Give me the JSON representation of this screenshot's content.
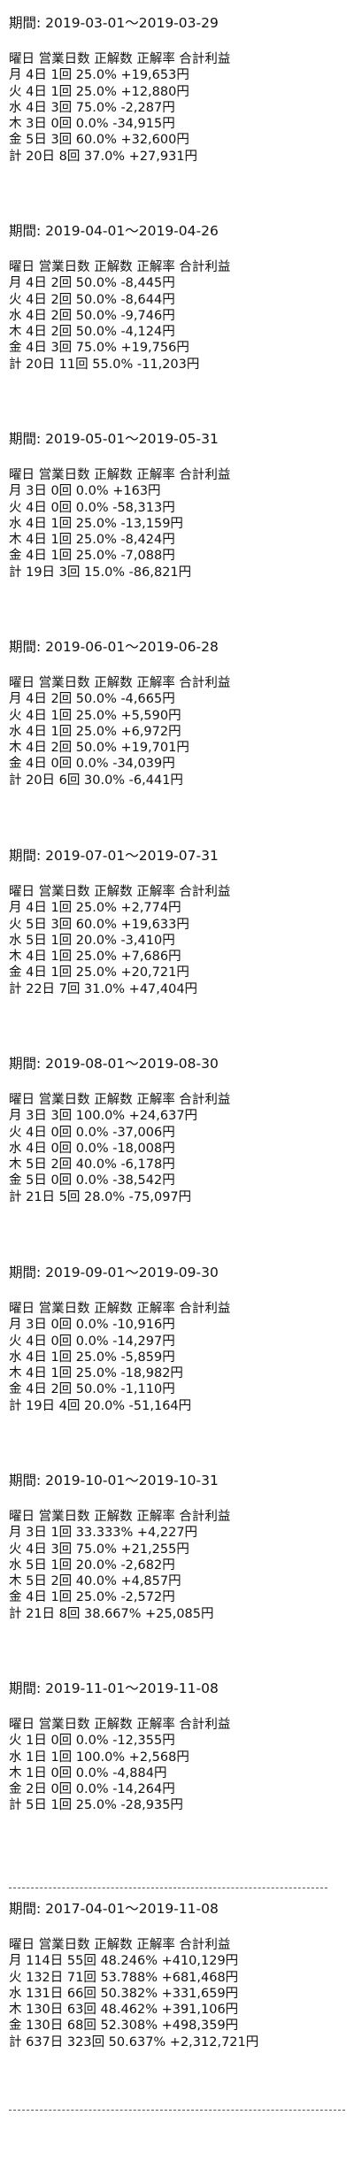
{
  "blocks": [
    {
      "period": "期間: 2019-03-01〜2019-03-29",
      "header": "曜日 営業日数 正解数 正解率 合計利益",
      "rows": [
        "月 4日 1回 25.0% +19,653円",
        "火 4日 1回 25.0% +12,880円",
        "水 4日 3回 75.0% -2,287円",
        "木 3日 0回 0.0% -34,915円",
        "金 5日 3回 60.0% +32,600円",
        "計 20日 8回 37.0% +27,931円"
      ]
    },
    {
      "period": "期間: 2019-04-01〜2019-04-26",
      "header": "曜日 営業日数 正解数 正解率 合計利益",
      "rows": [
        "月 4日 2回 50.0% -8,445円",
        "火 4日 2回 50.0% -8,644円",
        "水 4日 2回 50.0% -9,746円",
        "木 4日 2回 50.0% -4,124円",
        "金 4日 3回 75.0% +19,756円",
        "計 20日 11回 55.0% -11,203円"
      ]
    },
    {
      "period": "期間: 2019-05-01〜2019-05-31",
      "header": "曜日 営業日数 正解数 正解率 合計利益",
      "rows": [
        "月 3日 0回 0.0% +163円",
        "火 4日 0回 0.0% -58,313円",
        "水 4日 1回 25.0% -13,159円",
        "木 4日 1回 25.0% -8,424円",
        "金 4日 1回 25.0% -7,088円",
        "計 19日 3回 15.0% -86,821円"
      ]
    },
    {
      "period": "期間: 2019-06-01〜2019-06-28",
      "header": "曜日 営業日数 正解数 正解率 合計利益",
      "rows": [
        "月 4日 2回 50.0% -4,665円",
        "火 4日 1回 25.0% +5,590円",
        "水 4日 1回 25.0% +6,972円",
        "木 4日 2回 50.0% +19,701円",
        "金 4日 0回 0.0% -34,039円",
        "計 20日 6回 30.0% -6,441円"
      ]
    },
    {
      "period": "期間: 2019-07-01〜2019-07-31",
      "header": "曜日 営業日数 正解数 正解率 合計利益",
      "rows": [
        "月 4日 1回 25.0% +2,774円",
        "火 5日 3回 60.0% +19,633円",
        "水 5日 1回 20.0% -3,410円",
        "木 4日 1回 25.0% +7,686円",
        "金 4日 1回 25.0% +20,721円",
        "計 22日 7回 31.0% +47,404円"
      ]
    },
    {
      "period": "期間: 2019-08-01〜2019-08-30",
      "header": "曜日 営業日数 正解数 正解率 合計利益",
      "rows": [
        "月 3日 3回 100.0% +24,637円",
        "火 4日 0回 0.0% -37,006円",
        "水 4日 0回 0.0% -18,008円",
        "木 5日 2回 40.0% -6,178円",
        "金 5日 0回 0.0% -38,542円",
        "計 21日 5回 28.0% -75,097円"
      ]
    },
    {
      "period": "期間: 2019-09-01〜2019-09-30",
      "header": "曜日 営業日数 正解数 正解率 合計利益",
      "rows": [
        "月 3日 0回 0.0% -10,916円",
        "火 4日 0回 0.0% -14,297円",
        "水 4日 1回 25.0% -5,859円",
        "木 4日 1回 25.0% -18,982円",
        "金 4日 2回 50.0% -1,110円",
        "計 19日 4回 20.0% -51,164円"
      ]
    },
    {
      "period": "期間: 2019-10-01〜2019-10-31",
      "header": "曜日 営業日数 正解数 正解率 合計利益",
      "rows": [
        "月 3日 1回 33.333% +4,227円",
        "火 4日 3回 75.0% +21,255円",
        "水 5日 1回 20.0% -2,682円",
        "木 5日 2回 40.0% +4,857円",
        "金 4日 1回 25.0% -2,572円",
        "計 21日 8回 38.667% +25,085円"
      ]
    },
    {
      "period": "期間: 2019-11-01〜2019-11-08",
      "header": "曜日 営業日数 正解数 正解率 合計利益",
      "rows": [
        "火 1日 0回 0.0% -12,355円",
        "水 1日 1回 100.0% +2,568円",
        "木 1日 0回 0.0% -4,884円",
        "金 2日 0回 0.0% -14,264円",
        "計 5日 1回 25.0% -28,935円"
      ]
    },
    {
      "period": "期間: 2017-04-01〜2019-11-08",
      "header": "曜日 営業日数 正解数 正解率 合計利益",
      "rows": [
        "月 114日 55回 48.246% +410,129円",
        "火 132日 71回 53.788% +681,468円",
        "水 131日 66回 50.382% +331,659円",
        "木 130日 63回 48.462% +391,106円",
        "金 130日 68回 52.308% +498,359円",
        "計 637日 323回 50.637% +2,312,721円"
      ]
    }
  ]
}
